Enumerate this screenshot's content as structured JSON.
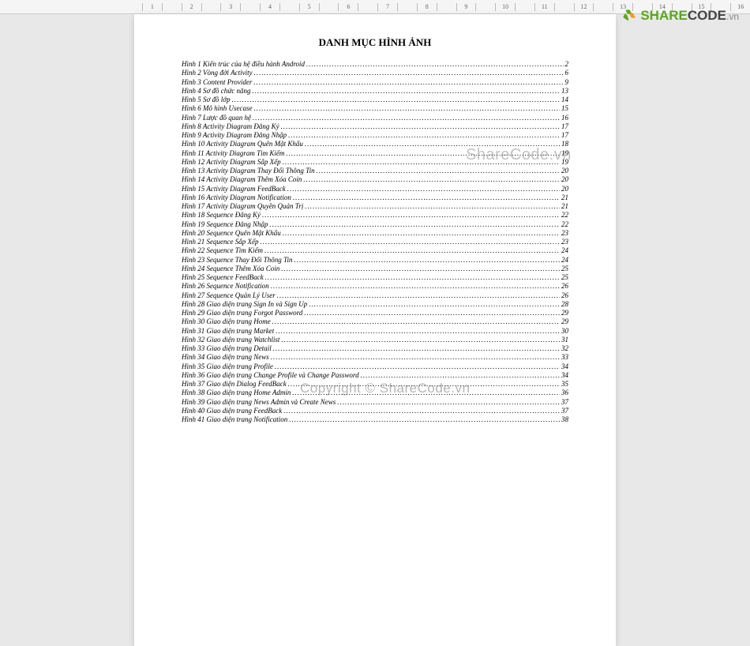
{
  "ruler": {
    "marks": [
      "1",
      "",
      "2",
      "",
      "3",
      "",
      "4",
      "",
      "5",
      "",
      "6",
      "",
      "7",
      "",
      "8",
      "",
      "9",
      "",
      "10",
      "",
      "11",
      "",
      "12",
      "",
      "13",
      "",
      "14",
      "",
      "15",
      "",
      "16"
    ]
  },
  "title": "DANH MỤC HÌNH ẢNH",
  "toc": [
    {
      "label": "Hình 1 Kiến trúc của hệ điều hành Android",
      "page": "2"
    },
    {
      "label": "Hình 2 Vòng đời Activity",
      "page": "6"
    },
    {
      "label": "Hình 3 Content Provider",
      "page": "9"
    },
    {
      "label": "Hình 4 Sơ đồ chức năng",
      "page": "13"
    },
    {
      "label": "Hình 5 Sơ đồ lớp",
      "page": "14"
    },
    {
      "label": "Hình 6 Mô hình Usecase",
      "page": "15"
    },
    {
      "label": "Hình 7 Lược đồ quan hệ",
      "page": "16"
    },
    {
      "label": "Hình 8 Activity Diagram Đăng Ký",
      "page": "17"
    },
    {
      "label": "Hình 9 Activity Diagram Đăng Nhập",
      "page": "17"
    },
    {
      "label": "Hình 10 Activity Diagram Quên Mật Khẩu",
      "page": "18"
    },
    {
      "label": "Hình 11 Activity Diagram Tìm Kiếm",
      "page": "19"
    },
    {
      "label": "Hình 12 Activity Diagram Sắp Xếp",
      "page": "19"
    },
    {
      "label": "Hình 13 Activity Diagram Thay Đổi Thông Tin",
      "page": "20"
    },
    {
      "label": "Hình 14 Activity Diagram Thêm Xóa Coin",
      "page": "20"
    },
    {
      "label": "Hình 15 Activity Diagram FeedBack",
      "page": "20"
    },
    {
      "label": "Hình 16 Activity Diagram Notification",
      "page": "21"
    },
    {
      "label": "Hình 17 Activity Diagram Quyền Quản Trị",
      "page": "21"
    },
    {
      "label": "Hình 18 Sequence Đăng Ký",
      "page": "22"
    },
    {
      "label": "Hình 19 Sequence Đăng Nhập",
      "page": "22"
    },
    {
      "label": "Hình 20 Sequence Quên Mật Khẩu",
      "page": "23"
    },
    {
      "label": "Hình 21 Sequence Sắp Xếp",
      "page": "23"
    },
    {
      "label": "Hình 22 Sequence Tìm Kiếm",
      "page": "24"
    },
    {
      "label": "Hình 23 Sequence Thay Đổi Thông Tin",
      "page": "24"
    },
    {
      "label": "Hình 24 Sequence Thêm Xóa Coin",
      "page": "25"
    },
    {
      "label": "Hình 25 Sequence FeedBack",
      "page": "25"
    },
    {
      "label": "Hình 26 Sequence Notification",
      "page": "26"
    },
    {
      "label": "Hình 27 Sequence Quản Lý User",
      "page": "26"
    },
    {
      "label": "Hình 28 Giao diện trang Sign In và Sign Up",
      "page": "28"
    },
    {
      "label": "Hình 29 Giao diện trang Forgot Password",
      "page": "29"
    },
    {
      "label": "Hình 30 Giao diện trang Home",
      "page": "29"
    },
    {
      "label": "Hình 31 Giao diện trang Market",
      "page": "30"
    },
    {
      "label": "Hình 32 Giao diện trang Watchlist",
      "page": "31"
    },
    {
      "label": "Hình 33 Giao diện trang Detail",
      "page": "32"
    },
    {
      "label": "Hình 34 Giao diện trang News",
      "page": "33"
    },
    {
      "label": "Hình 35 Giao diện trang Profile",
      "page": "34"
    },
    {
      "label": "Hình 36 Giao diện trang Change Profile và Change Password",
      "page": "34"
    },
    {
      "label": "Hình 37 Giao diện Dialog FeedBack",
      "page": "35"
    },
    {
      "label": "Hình 38 Giao diện trang Home Admin",
      "page": "36"
    },
    {
      "label": "Hình 39 Giao diện trang News Admin và Create News",
      "page": "37"
    },
    {
      "label": "Hình 40 Giao diện trang FeedBack",
      "page": "37"
    },
    {
      "label": "Hình 41 Giao diện trang Notification",
      "page": "38"
    }
  ],
  "logo": {
    "green": "SHARE",
    "dark": "CODE",
    "ext": ".vn"
  },
  "watermarks": {
    "wm1": "ShareCode.vn",
    "wm2": "Copyright © ShareCode.vn"
  }
}
